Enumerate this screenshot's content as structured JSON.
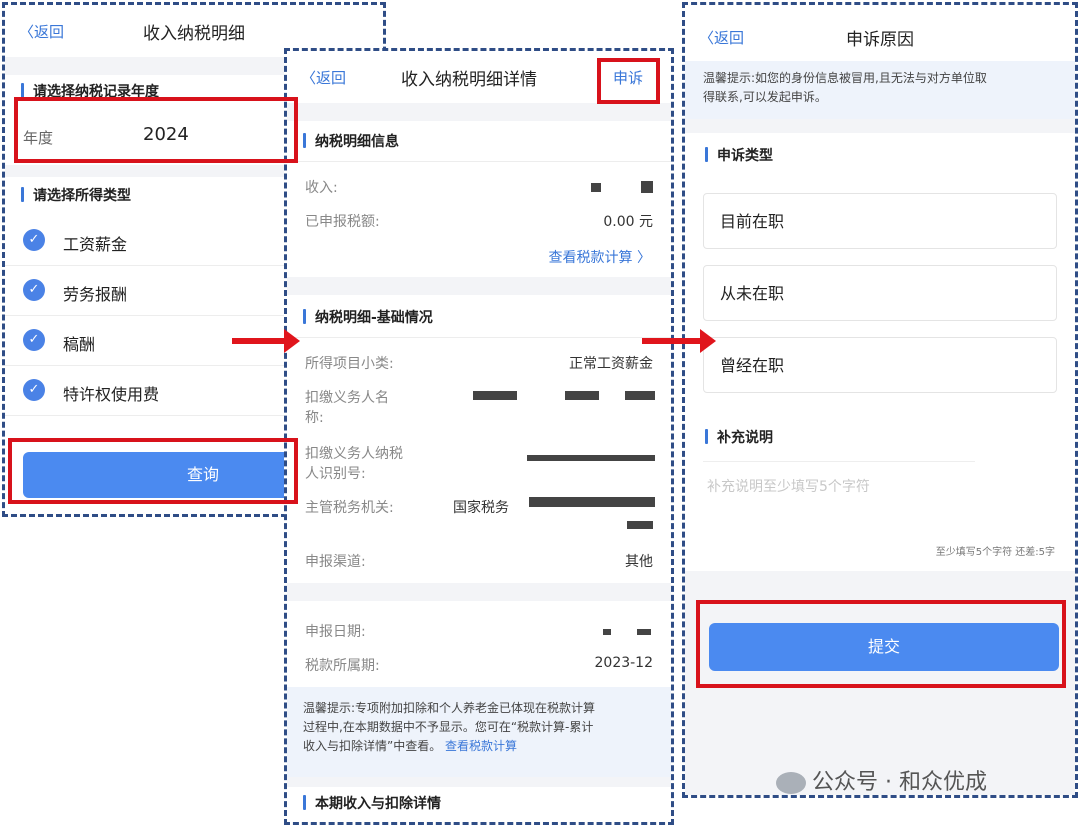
{
  "panel1": {
    "back": "返回",
    "title": "收入纳税明细",
    "year_section": "请选择纳税记录年度",
    "year_label": "年度",
    "year_value": "2024",
    "type_section": "请选择所得类型",
    "types": [
      "工资薪金",
      "劳务报酬",
      "稿酬",
      "特许权使用费"
    ],
    "query_button": "查询"
  },
  "panel2": {
    "back": "返回",
    "title": "收入纳税明细详情",
    "appeal": "申诉",
    "section1": "纳税明细信息",
    "income_label": "收入:",
    "declared_tax_label": "已申报税额:",
    "declared_tax_value": "0.00 元",
    "view_calc": "查看税款计算",
    "section2": "纳税明细-基础情况",
    "item_label": "所得项目小类:",
    "item_value": "正常工资薪金",
    "withholder_name_label_1": "扣缴义务人名",
    "withholder_name_label_2": "称:",
    "withholder_id_label_1": "扣缴义务人纳税",
    "withholder_id_label_2": "人识别号:",
    "authority_label": "主管税务机关:",
    "authority_value": "国家税务",
    "channel_label": "申报渠道:",
    "channel_value": "其他",
    "date_label": "申报日期:",
    "period_label": "税款所属期:",
    "period_value": "2023-12",
    "tip_line1": "温馨提示:专项附加扣除和个人养老金已体现在税款计算",
    "tip_line2": "过程中,在本期数据中不予显示。您可在“税款计算-累计",
    "tip_line3": "收入与扣除详情”中查看。",
    "tip_link": "查看税款计算",
    "section3": "本期收入与扣除详情"
  },
  "panel3": {
    "back": "返回",
    "title": "申诉原因",
    "tip_line1": "温馨提示:如您的身份信息被冒用,且无法与对方单位取",
    "tip_line2": "得联系,可以发起申诉。",
    "type_section": "申诉类型",
    "options": [
      "目前在职",
      "从未在职",
      "曾经在职"
    ],
    "supplement_section": "补充说明",
    "supplement_placeholder": "补充说明至少填写5个字符",
    "counter": "至少填写5个字符 还差:5字",
    "submit_button": "提交"
  },
  "watermark": "公众号 · 和众优成",
  "colors": {
    "accent": "#4b8af0",
    "highlight": "#d8121b",
    "link": "#3a77d8",
    "border": "#2f4d86"
  }
}
